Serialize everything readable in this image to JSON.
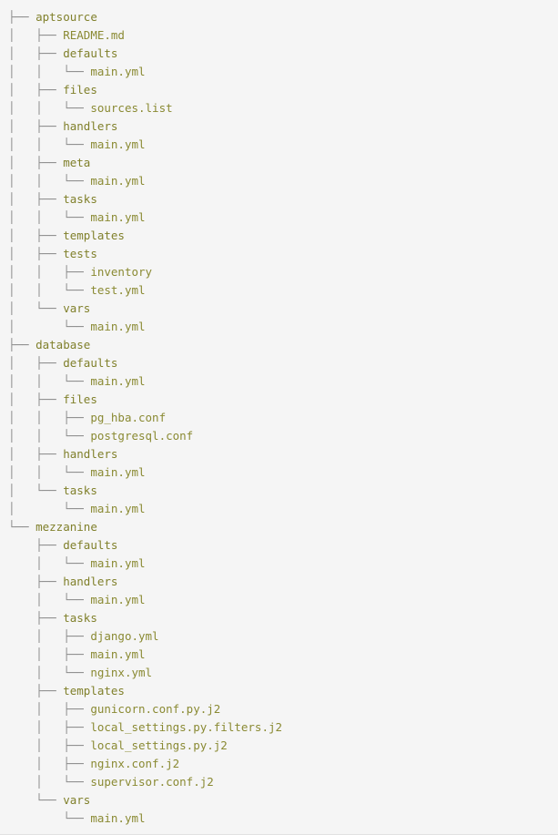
{
  "view": {
    "kind": "terminal-tree-output",
    "command_name": "tree",
    "background_color": "#f5f5f5",
    "prefix_color": "#8b8b8b",
    "directory_color": "#80802b",
    "file_color": "#8a8a33"
  },
  "tree": {
    "rows": [
      {
        "prefix": "├── ",
        "name": "aptsource",
        "type": "dir"
      },
      {
        "prefix": "│   ├── ",
        "name": "README.md",
        "type": "file"
      },
      {
        "prefix": "│   ├── ",
        "name": "defaults",
        "type": "dir"
      },
      {
        "prefix": "│   │   └── ",
        "name": "main.yml",
        "type": "file"
      },
      {
        "prefix": "│   ├── ",
        "name": "files",
        "type": "dir"
      },
      {
        "prefix": "│   │   └── ",
        "name": "sources.list",
        "type": "file"
      },
      {
        "prefix": "│   ├── ",
        "name": "handlers",
        "type": "dir"
      },
      {
        "prefix": "│   │   └── ",
        "name": "main.yml",
        "type": "file"
      },
      {
        "prefix": "│   ├── ",
        "name": "meta",
        "type": "dir"
      },
      {
        "prefix": "│   │   └── ",
        "name": "main.yml",
        "type": "file"
      },
      {
        "prefix": "│   ├── ",
        "name": "tasks",
        "type": "dir"
      },
      {
        "prefix": "│   │   └── ",
        "name": "main.yml",
        "type": "file"
      },
      {
        "prefix": "│   ├── ",
        "name": "templates",
        "type": "dir"
      },
      {
        "prefix": "│   ├── ",
        "name": "tests",
        "type": "dir"
      },
      {
        "prefix": "│   │   ├── ",
        "name": "inventory",
        "type": "file"
      },
      {
        "prefix": "│   │   └── ",
        "name": "test.yml",
        "type": "file"
      },
      {
        "prefix": "│   └── ",
        "name": "vars",
        "type": "dir"
      },
      {
        "prefix": "│       └── ",
        "name": "main.yml",
        "type": "file"
      },
      {
        "prefix": "├── ",
        "name": "database",
        "type": "dir"
      },
      {
        "prefix": "│   ├── ",
        "name": "defaults",
        "type": "dir"
      },
      {
        "prefix": "│   │   └── ",
        "name": "main.yml",
        "type": "file"
      },
      {
        "prefix": "│   ├── ",
        "name": "files",
        "type": "dir"
      },
      {
        "prefix": "│   │   ├── ",
        "name": "pg_hba.conf",
        "type": "file"
      },
      {
        "prefix": "│   │   └── ",
        "name": "postgresql.conf",
        "type": "file"
      },
      {
        "prefix": "│   ├── ",
        "name": "handlers",
        "type": "dir"
      },
      {
        "prefix": "│   │   └── ",
        "name": "main.yml",
        "type": "file"
      },
      {
        "prefix": "│   └── ",
        "name": "tasks",
        "type": "dir"
      },
      {
        "prefix": "│       └── ",
        "name": "main.yml",
        "type": "file"
      },
      {
        "prefix": "└── ",
        "name": "mezzanine",
        "type": "dir"
      },
      {
        "prefix": "    ├── ",
        "name": "defaults",
        "type": "dir"
      },
      {
        "prefix": "    │   └── ",
        "name": "main.yml",
        "type": "file"
      },
      {
        "prefix": "    ├── ",
        "name": "handlers",
        "type": "dir"
      },
      {
        "prefix": "    │   └── ",
        "name": "main.yml",
        "type": "file"
      },
      {
        "prefix": "    ├── ",
        "name": "tasks",
        "type": "dir"
      },
      {
        "prefix": "    │   ├── ",
        "name": "django.yml",
        "type": "file"
      },
      {
        "prefix": "    │   ├── ",
        "name": "main.yml",
        "type": "file"
      },
      {
        "prefix": "    │   └── ",
        "name": "nginx.yml",
        "type": "file"
      },
      {
        "prefix": "    ├── ",
        "name": "templates",
        "type": "dir"
      },
      {
        "prefix": "    │   ├── ",
        "name": "gunicorn.conf.py.j2",
        "type": "file"
      },
      {
        "prefix": "    │   ├── ",
        "name": "local_settings.py.filters.j2",
        "type": "file"
      },
      {
        "prefix": "    │   ├── ",
        "name": "local_settings.py.j2",
        "type": "file"
      },
      {
        "prefix": "    │   ├── ",
        "name": "nginx.conf.j2",
        "type": "file"
      },
      {
        "prefix": "    │   └── ",
        "name": "supervisor.conf.j2",
        "type": "file"
      },
      {
        "prefix": "    └── ",
        "name": "vars",
        "type": "dir"
      },
      {
        "prefix": "        └── ",
        "name": "main.yml",
        "type": "file"
      }
    ]
  }
}
